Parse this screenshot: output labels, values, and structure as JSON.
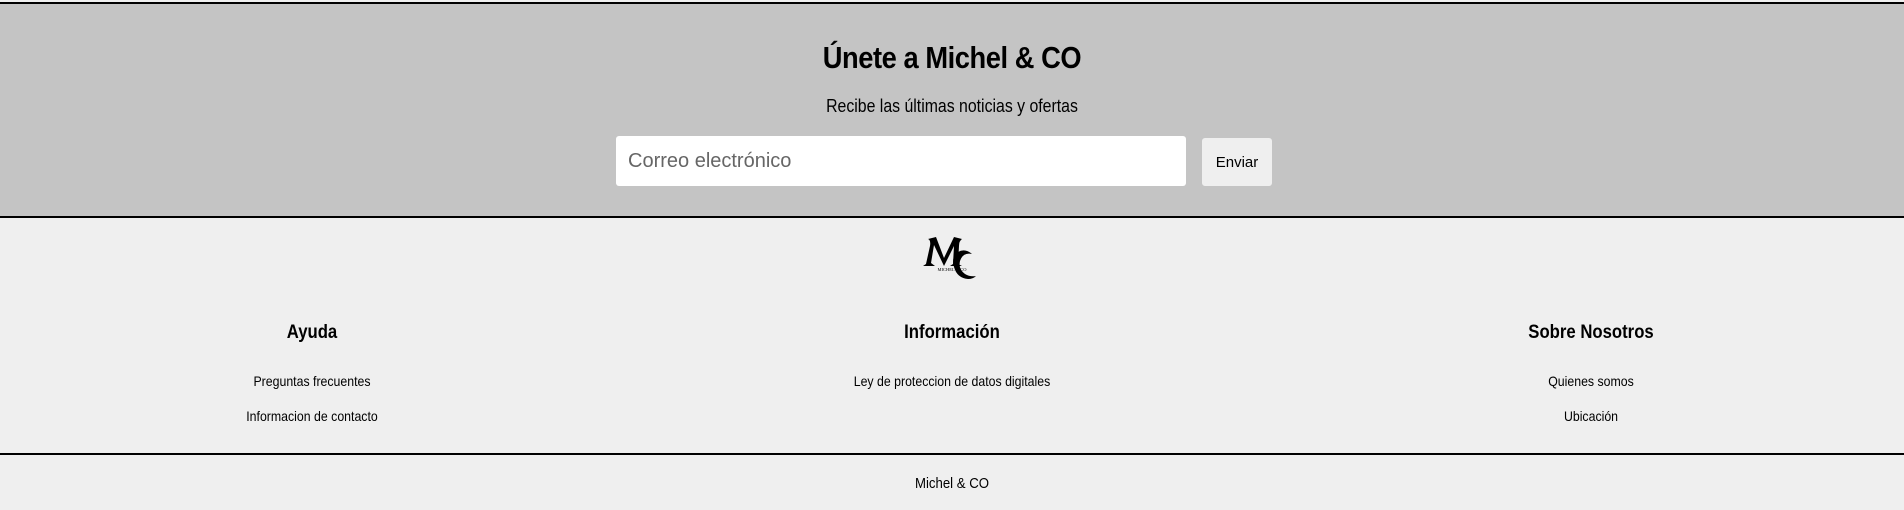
{
  "newsletter": {
    "title": "Únete a Michel & CO",
    "subtitle": "Recibe las últimas noticias y ofertas",
    "email_placeholder": "Correo electrónico",
    "email_value": "",
    "submit_label": "Enviar"
  },
  "footer": {
    "logo": {
      "icon": "michel-co-logo",
      "initials": "MC",
      "wordmark": "MICHEL & CO"
    },
    "columns": [
      {
        "title": "Ayuda",
        "links": [
          "Preguntas frecuentes",
          "Informacion de contacto"
        ]
      },
      {
        "title": "Información",
        "links": [
          "Ley de proteccion de datos digitales"
        ]
      },
      {
        "title": "Sobre Nosotros",
        "links": [
          "Quienes somos",
          "Ubicación"
        ]
      }
    ],
    "copyright": "Michel & CO"
  },
  "colors": {
    "newsletter_bg": "#c4c4c4",
    "footer_bg": "#efefef",
    "text": "#000000",
    "border": "#000000"
  }
}
